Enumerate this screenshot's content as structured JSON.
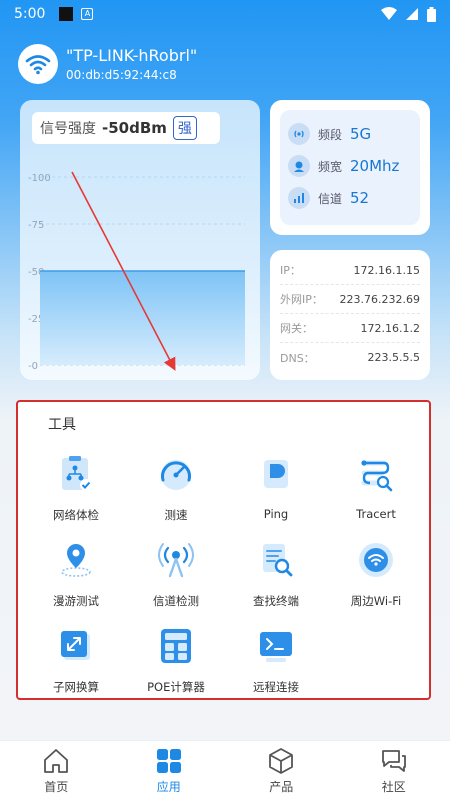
{
  "status_bar": {
    "time": "5:00",
    "a_icon": "A"
  },
  "wifi": {
    "ssid": "\"TP-LINK-hRobrl\"",
    "mac": "00:db:d5:92:44:c8"
  },
  "signal": {
    "title": "信号强度",
    "value": "-50dBm",
    "badge": "强",
    "level_dbm": -50,
    "axis_ticks": [
      "-100",
      "-75",
      "-50",
      "-25",
      "-0"
    ]
  },
  "radio_info": [
    {
      "icon": "band-icon",
      "key": "频段",
      "value": "5G"
    },
    {
      "icon": "bandwidth-icon",
      "key": "频宽",
      "value": "20Mhz"
    },
    {
      "icon": "channel-icon",
      "key": "信道",
      "value": "52"
    }
  ],
  "network": [
    {
      "key": "IP：",
      "value": "172.16.1.15"
    },
    {
      "key": "外网IP：",
      "value": "223.76.232.69"
    },
    {
      "key": "网关：",
      "value": "172.16.1.2"
    },
    {
      "key": "DNS：",
      "value": "223.5.5.5"
    }
  ],
  "tools": {
    "title": "工具",
    "items": [
      {
        "name": "network-check",
        "label": "网络体检",
        "icon": "network-check-icon"
      },
      {
        "name": "speed-test",
        "label": "测速",
        "icon": "speedometer-icon"
      },
      {
        "name": "ping",
        "label": "Ping",
        "icon": "ping-icon"
      },
      {
        "name": "tracert",
        "label": "Tracert",
        "icon": "tracert-icon"
      },
      {
        "name": "roaming-test",
        "label": "漫游测试",
        "icon": "location-pin-icon"
      },
      {
        "name": "channel-check",
        "label": "信道检测",
        "icon": "antenna-icon"
      },
      {
        "name": "find-terminal",
        "label": "查找终端",
        "icon": "document-search-icon"
      },
      {
        "name": "nearby-wifi",
        "label": "周边Wi-Fi",
        "icon": "wifi-icon"
      },
      {
        "name": "subnet-calc",
        "label": "子网换算",
        "icon": "subnet-icon"
      },
      {
        "name": "poe-calc",
        "label": "POE计算器",
        "icon": "calculator-icon"
      },
      {
        "name": "remote-connect",
        "label": "远程连接",
        "icon": "terminal-icon"
      }
    ]
  },
  "bottom_nav": [
    {
      "label": "首页",
      "icon": "home-icon"
    },
    {
      "label": "应用",
      "icon": "apps-grid-icon",
      "active": true
    },
    {
      "label": "产品",
      "icon": "cube-icon"
    },
    {
      "label": "社区",
      "icon": "chat-icon"
    }
  ],
  "colors": {
    "primary": "#1E88E5",
    "highlight_border": "#D32F2F",
    "annotation_arrow": "#E53935"
  }
}
